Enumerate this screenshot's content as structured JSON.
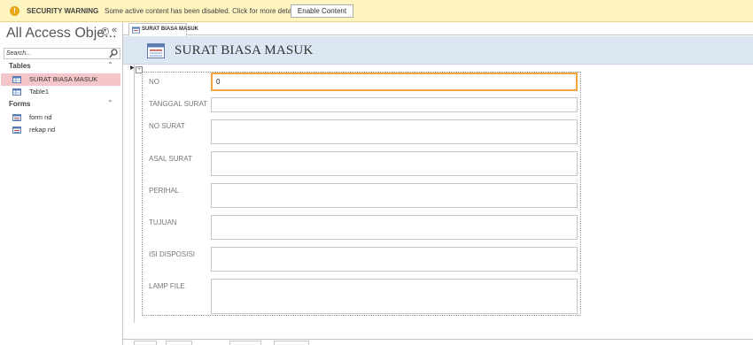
{
  "security_bar": {
    "icon": "warning-icon",
    "title": "SECURITY WARNING",
    "message": "Some active content has been disabled. Click for more details.",
    "enable_button": "Enable Content"
  },
  "nav_pane": {
    "title": "All Access Obje...",
    "search_placeholder": "Search...",
    "groups": [
      {
        "label": "Tables",
        "items": [
          {
            "label": "SURAT BIASA MASUK",
            "icon": "table-icon",
            "selected": true
          },
          {
            "label": "Table1",
            "icon": "table-icon",
            "selected": false
          }
        ]
      },
      {
        "label": "Forms",
        "items": [
          {
            "label": "form nd",
            "icon": "form-icon",
            "selected": false
          },
          {
            "label": "rekap nd",
            "icon": "form-icon",
            "selected": false
          }
        ]
      }
    ]
  },
  "tab": {
    "label": "SURAT BIASA MASUK"
  },
  "form": {
    "title": "SURAT BIASA MASUK",
    "fields": [
      {
        "label": "NO",
        "value": "0"
      },
      {
        "label": "TANGGAL SURAT",
        "value": ""
      },
      {
        "label": "NO SURAT",
        "value": ""
      },
      {
        "label": "ASAL SURAT",
        "value": ""
      },
      {
        "label": "PERIHAL",
        "value": ""
      },
      {
        "label": "TUJUAN",
        "value": ""
      },
      {
        "label": "ISI DISPOSISI",
        "value": ""
      },
      {
        "label": "LAMP FILE",
        "value": ""
      }
    ]
  },
  "colors": {
    "security_bar": "#fdf4bf",
    "selected_item": "#f5c6c9",
    "form_header": "#dde7f3",
    "focus_border": "#f3a63f"
  }
}
